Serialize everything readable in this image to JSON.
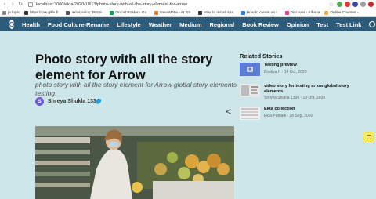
{
  "browser": {
    "url": "localhost:3000/ekta/2020/10/13/photo-story-with-all-the-story-element-for-arrow",
    "bookmarks": [
      {
        "label": "je topic",
        "color": "#888888"
      },
      {
        "label": "https://raw.github...",
        "color": "#333333"
      },
      {
        "label": "axios/axios: Promi...",
        "color": "#555555"
      },
      {
        "label": "Oncall Roster - Go...",
        "color": "#0f9d58"
      },
      {
        "label": "NewsWise - AI RS...",
        "color": "#e67e22"
      },
      {
        "label": "How to install spa...",
        "color": "#333333"
      },
      {
        "label": "How to create an i...",
        "color": "#2c7be5"
      },
      {
        "label": "Discover - Kibana",
        "color": "#e83e8c"
      },
      {
        "label": "Online Courses -...",
        "color": "#f0ad4e"
      }
    ],
    "extension_colors": [
      "#4caf50",
      "#e53935",
      "#3949ab",
      "#9e9e9e",
      "#c62828"
    ]
  },
  "site": {
    "menu": [
      "Health",
      "Food Culture-Rename",
      "Lifestyle",
      "Weather",
      "Medium",
      "Regional",
      "Book Review",
      "Opinion",
      "Test",
      "Test Link"
    ],
    "nav_color": "#2d5c7a"
  },
  "article": {
    "title": "Photo story with all the story element for Arrow",
    "subtitle": "photo story with all the story element for Arrow global story elements testing",
    "author_initial": "S",
    "author_name": "Shreya Shukla 1334"
  },
  "related": {
    "heading": "Related Stories",
    "items": [
      {
        "title": "Testing preview",
        "meta": "Bindiya H  ·  14 Oct, 2020"
      },
      {
        "title": "video story for texting arrow global story elements",
        "meta": "Shreya Shukla 1334  ·  13 Oct, 2020"
      },
      {
        "title": "Ekta collection",
        "meta": "Ekta Patnaik  ·  28 Sep, 2020"
      }
    ]
  }
}
